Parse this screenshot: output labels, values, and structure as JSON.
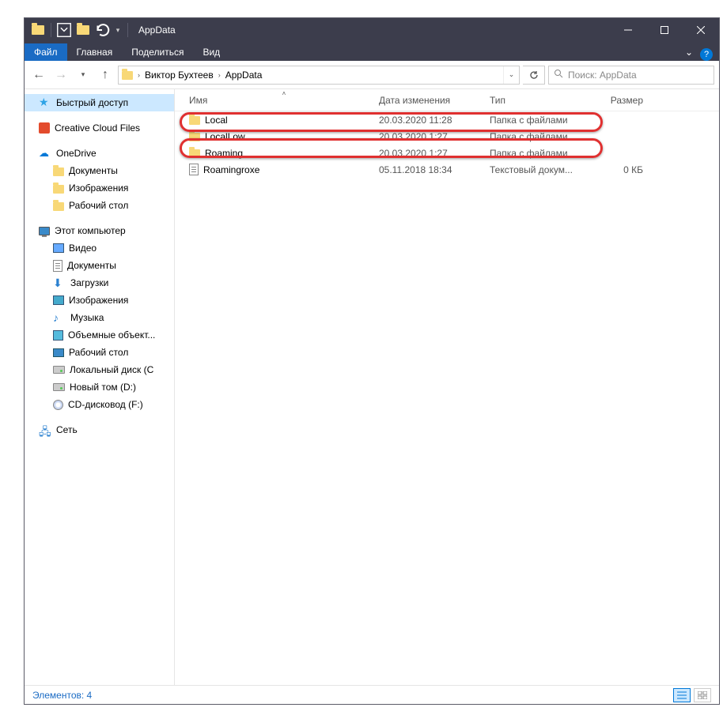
{
  "title": "AppData",
  "ribbon": {
    "file": "Файл",
    "home": "Главная",
    "share": "Поделиться",
    "view": "Вид"
  },
  "breadcrumb": {
    "user": "Виктор Бухтеев",
    "folder": "AppData"
  },
  "search": {
    "placeholder": "Поиск: AppData"
  },
  "sidebar": {
    "quick_access": "Быстрый доступ",
    "creative_cloud": "Creative Cloud Files",
    "onedrive": "OneDrive",
    "od_docs": "Документы",
    "od_images": "Изображения",
    "od_desktop": "Рабочий стол",
    "this_pc": "Этот компьютер",
    "video": "Видео",
    "documents": "Документы",
    "downloads": "Загрузки",
    "images": "Изображения",
    "music": "Музыка",
    "objects3d": "Объемные объект...",
    "desktop": "Рабочий стол",
    "local_disk": "Локальный диск (C",
    "new_vol": "Новый том (D:)",
    "cd_drive": "CD-дисковод (F:)",
    "network": "Сеть"
  },
  "columns": {
    "name": "Имя",
    "date": "Дата изменения",
    "type": "Тип",
    "size": "Размер"
  },
  "rows": [
    {
      "name": "Local",
      "date": "20.03.2020 11:28",
      "type": "Папка с файлами",
      "size": "",
      "kind": "folder"
    },
    {
      "name": "LocalLow",
      "date": "20.03.2020 1:27",
      "type": "Папка с файлами",
      "size": "",
      "kind": "folder"
    },
    {
      "name": "Roaming",
      "date": "20.03.2020 1:27",
      "type": "Папка с файлами",
      "size": "",
      "kind": "folder"
    },
    {
      "name": "Roamingroxe",
      "date": "05.11.2018 18:34",
      "type": "Текстовый докум...",
      "size": "0 КБ",
      "kind": "doc"
    }
  ],
  "status": "Элементов: 4"
}
